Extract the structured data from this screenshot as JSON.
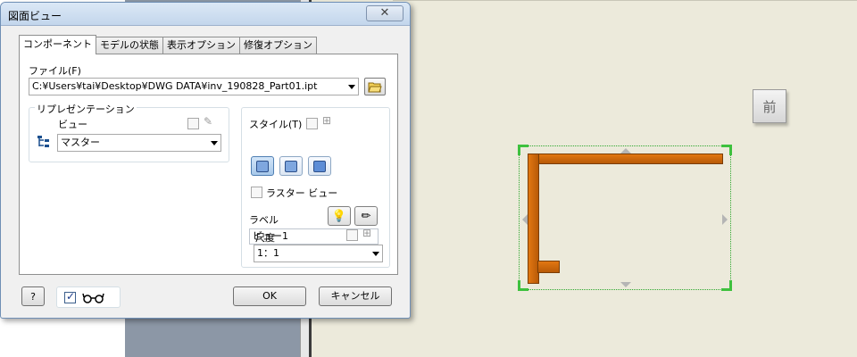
{
  "dialog": {
    "title": "図面ビュー",
    "close_label": "✕",
    "tabs": [
      {
        "label": "コンポーネント"
      },
      {
        "label": "モデルの状態"
      },
      {
        "label": "表示オプション"
      },
      {
        "label": "修復オプション"
      }
    ],
    "file": {
      "label": "ファイル(F)",
      "value": "C:¥Users¥tai¥Desktop¥DWG DATA¥inv_190828_Part01.ipt"
    },
    "representation": {
      "group_title": "リプレゼンテーション",
      "view_label": "ビュー",
      "view_value": "マスター"
    },
    "style": {
      "label": "スタイル(T)",
      "raster_label": "ラスター ビュー",
      "label_caption": "ラベル",
      "label_value": "ビュー1",
      "scale_label": "尺度",
      "scale_value": "1：1"
    },
    "buttons": {
      "ok": "OK",
      "cancel": "キャンセル",
      "help": "?"
    }
  },
  "canvas": {
    "viewcube_label": "前"
  },
  "colors": {
    "part_orange": "#d4690e",
    "selection_green": "#3ec13e",
    "canvas_bg": "#eceadb"
  }
}
